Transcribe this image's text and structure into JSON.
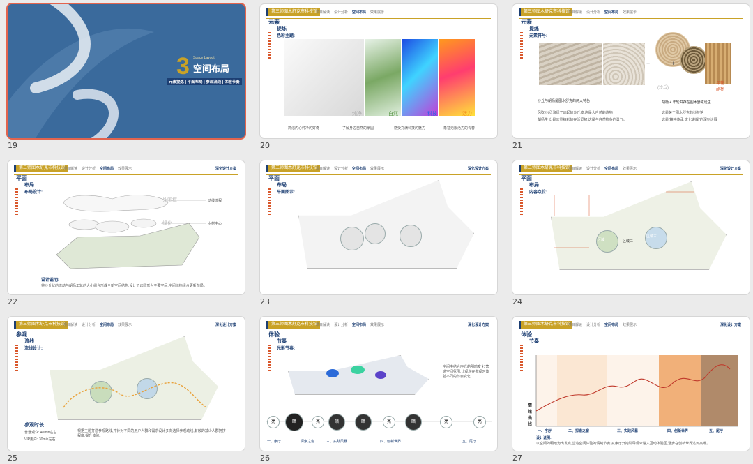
{
  "header": {
    "title": "第三师图木舒克市科技馆",
    "tabs": [
      "项目解读",
      "设计分析",
      "空间布局",
      "效果展示"
    ],
    "active_tab": "空间布局",
    "right": "深化设计方案"
  },
  "slides": [
    {
      "num": "19",
      "chapter_no": "3",
      "chapter_en": "Space Layout",
      "chapter_title": "空间布局",
      "chapter_sub": "元素提炼 | 平面布局 | 参观流线 | 体验节奏"
    },
    {
      "num": "20",
      "sec_a": "元素",
      "sec_b": "提炼",
      "sub": "色彩主题:",
      "labels": [
        "纯净",
        "自然",
        "科技",
        "活力"
      ],
      "captions": [
        "简洁内心纯净的好奇",
        "了解身边自然的家园",
        "感受充满科技的魅力",
        "象征无限活力的青春"
      ]
    },
    {
      "num": "21",
      "sec_a": "元素",
      "sec_b": "提炼",
      "sub": "元素符号:",
      "plus1": "+",
      "plus2": "+",
      "lbl_sand": "(沙丘)",
      "lbl_tree": "年轮\n胡杨",
      "left1": "沙丘与胡杨是图木舒克的两大特色",
      "left2": "风吹沙起,演绎了动起的沙丘坡,这是大自然的造物",
      "left3": "胡杨生长,是三重精彩的存活坚韧,这是与自然抗争的勇气。",
      "right1": "胡杨 + 年轮共存在图木舒克诞生",
      "right2": "这是关于图木舒克的科技馆",
      "right3": "这是“精神传承 文化讲解”的深刻诠释"
    },
    {
      "num": "22",
      "sec_a": "平面",
      "sec_b": "布局",
      "sub": "布局设计:",
      "lbl1": "外围框",
      "lbl2": "绿化",
      "r1": "动线流程",
      "r2": "木材中心",
      "cap_title": "设计说明:",
      "cap": "将沙丘状的流动与胡杨年轮的大小组合形成全新空间结构,设计了以圆形为主要空间,空间结构组合更新布局。"
    },
    {
      "num": "23",
      "sec_a": "平面",
      "sec_b": "布局",
      "sub": "平面图示:"
    },
    {
      "num": "24",
      "sec_a": "平面",
      "sec_b": "布局",
      "sub": "内容点位:",
      "zones": [
        "区域一",
        "区域二",
        "区域三"
      ]
    },
    {
      "num": "25",
      "sec_a": "参观",
      "sec_b": "流线",
      "sub": "流线设计:",
      "cap_title": "参观时长:",
      "cap1": "普通观众: 40min左右",
      "cap2": "VIP用户: 30min左右",
      "cap3": "根据主题打造参观路线,并针对不同的用户人群和需求设计多向选择参观动线,有效的减少人群拥挤程度,提升体验。"
    },
    {
      "num": "26",
      "sec_a": "体验",
      "sec_b": "节奏",
      "sub": "光影节奏:",
      "circles": [
        "亮",
        "暗",
        "亮",
        "暗",
        "暗",
        "亮",
        "暗",
        "亮",
        "亮"
      ],
      "phases": [
        "一、序厅",
        "二、探索之窗",
        "三、实践风暴",
        "四、创新世界",
        "五、尾厅"
      ],
      "side_txt": "空间中结合序光的明暗变化,营造空间氛围,让观众在参观时体验不同的节奏变化"
    },
    {
      "num": "27",
      "sec_a": "体验",
      "sec_b": "节奏",
      "ylab": "情绪曲线",
      "phases": [
        "一、序厅",
        "二、探索之窗",
        "三、实践风暴",
        "四、创新世界",
        "五、尾厅"
      ],
      "cap_title": "设计说明:",
      "cap": "以空间的明暗为出发点,营造空间体验的情绪节奏,从序厅开始引导观众进入互动体验区,逐步在创新世界达到高潮。"
    }
  ],
  "colors": {
    "accent": "#c9a227",
    "navy": "#1d3f73",
    "select": "#e2644e",
    "orange": "#d9572b",
    "cover_bg": "#3a6a9c"
  }
}
